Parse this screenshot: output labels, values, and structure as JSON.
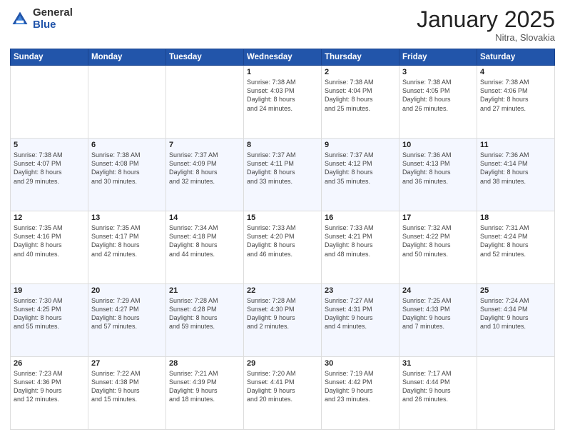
{
  "header": {
    "logo_general": "General",
    "logo_blue": "Blue",
    "month": "January 2025",
    "location": "Nitra, Slovakia"
  },
  "weekdays": [
    "Sunday",
    "Monday",
    "Tuesday",
    "Wednesday",
    "Thursday",
    "Friday",
    "Saturday"
  ],
  "weeks": [
    [
      {
        "day": "",
        "info": ""
      },
      {
        "day": "",
        "info": ""
      },
      {
        "day": "",
        "info": ""
      },
      {
        "day": "1",
        "info": "Sunrise: 7:38 AM\nSunset: 4:03 PM\nDaylight: 8 hours\nand 24 minutes."
      },
      {
        "day": "2",
        "info": "Sunrise: 7:38 AM\nSunset: 4:04 PM\nDaylight: 8 hours\nand 25 minutes."
      },
      {
        "day": "3",
        "info": "Sunrise: 7:38 AM\nSunset: 4:05 PM\nDaylight: 8 hours\nand 26 minutes."
      },
      {
        "day": "4",
        "info": "Sunrise: 7:38 AM\nSunset: 4:06 PM\nDaylight: 8 hours\nand 27 minutes."
      }
    ],
    [
      {
        "day": "5",
        "info": "Sunrise: 7:38 AM\nSunset: 4:07 PM\nDaylight: 8 hours\nand 29 minutes."
      },
      {
        "day": "6",
        "info": "Sunrise: 7:38 AM\nSunset: 4:08 PM\nDaylight: 8 hours\nand 30 minutes."
      },
      {
        "day": "7",
        "info": "Sunrise: 7:37 AM\nSunset: 4:09 PM\nDaylight: 8 hours\nand 32 minutes."
      },
      {
        "day": "8",
        "info": "Sunrise: 7:37 AM\nSunset: 4:11 PM\nDaylight: 8 hours\nand 33 minutes."
      },
      {
        "day": "9",
        "info": "Sunrise: 7:37 AM\nSunset: 4:12 PM\nDaylight: 8 hours\nand 35 minutes."
      },
      {
        "day": "10",
        "info": "Sunrise: 7:36 AM\nSunset: 4:13 PM\nDaylight: 8 hours\nand 36 minutes."
      },
      {
        "day": "11",
        "info": "Sunrise: 7:36 AM\nSunset: 4:14 PM\nDaylight: 8 hours\nand 38 minutes."
      }
    ],
    [
      {
        "day": "12",
        "info": "Sunrise: 7:35 AM\nSunset: 4:16 PM\nDaylight: 8 hours\nand 40 minutes."
      },
      {
        "day": "13",
        "info": "Sunrise: 7:35 AM\nSunset: 4:17 PM\nDaylight: 8 hours\nand 42 minutes."
      },
      {
        "day": "14",
        "info": "Sunrise: 7:34 AM\nSunset: 4:18 PM\nDaylight: 8 hours\nand 44 minutes."
      },
      {
        "day": "15",
        "info": "Sunrise: 7:33 AM\nSunset: 4:20 PM\nDaylight: 8 hours\nand 46 minutes."
      },
      {
        "day": "16",
        "info": "Sunrise: 7:33 AM\nSunset: 4:21 PM\nDaylight: 8 hours\nand 48 minutes."
      },
      {
        "day": "17",
        "info": "Sunrise: 7:32 AM\nSunset: 4:22 PM\nDaylight: 8 hours\nand 50 minutes."
      },
      {
        "day": "18",
        "info": "Sunrise: 7:31 AM\nSunset: 4:24 PM\nDaylight: 8 hours\nand 52 minutes."
      }
    ],
    [
      {
        "day": "19",
        "info": "Sunrise: 7:30 AM\nSunset: 4:25 PM\nDaylight: 8 hours\nand 55 minutes."
      },
      {
        "day": "20",
        "info": "Sunrise: 7:29 AM\nSunset: 4:27 PM\nDaylight: 8 hours\nand 57 minutes."
      },
      {
        "day": "21",
        "info": "Sunrise: 7:28 AM\nSunset: 4:28 PM\nDaylight: 8 hours\nand 59 minutes."
      },
      {
        "day": "22",
        "info": "Sunrise: 7:28 AM\nSunset: 4:30 PM\nDaylight: 9 hours\nand 2 minutes."
      },
      {
        "day": "23",
        "info": "Sunrise: 7:27 AM\nSunset: 4:31 PM\nDaylight: 9 hours\nand 4 minutes."
      },
      {
        "day": "24",
        "info": "Sunrise: 7:25 AM\nSunset: 4:33 PM\nDaylight: 9 hours\nand 7 minutes."
      },
      {
        "day": "25",
        "info": "Sunrise: 7:24 AM\nSunset: 4:34 PM\nDaylight: 9 hours\nand 10 minutes."
      }
    ],
    [
      {
        "day": "26",
        "info": "Sunrise: 7:23 AM\nSunset: 4:36 PM\nDaylight: 9 hours\nand 12 minutes."
      },
      {
        "day": "27",
        "info": "Sunrise: 7:22 AM\nSunset: 4:38 PM\nDaylight: 9 hours\nand 15 minutes."
      },
      {
        "day": "28",
        "info": "Sunrise: 7:21 AM\nSunset: 4:39 PM\nDaylight: 9 hours\nand 18 minutes."
      },
      {
        "day": "29",
        "info": "Sunrise: 7:20 AM\nSunset: 4:41 PM\nDaylight: 9 hours\nand 20 minutes."
      },
      {
        "day": "30",
        "info": "Sunrise: 7:19 AM\nSunset: 4:42 PM\nDaylight: 9 hours\nand 23 minutes."
      },
      {
        "day": "31",
        "info": "Sunrise: 7:17 AM\nSunset: 4:44 PM\nDaylight: 9 hours\nand 26 minutes."
      },
      {
        "day": "",
        "info": ""
      }
    ]
  ]
}
